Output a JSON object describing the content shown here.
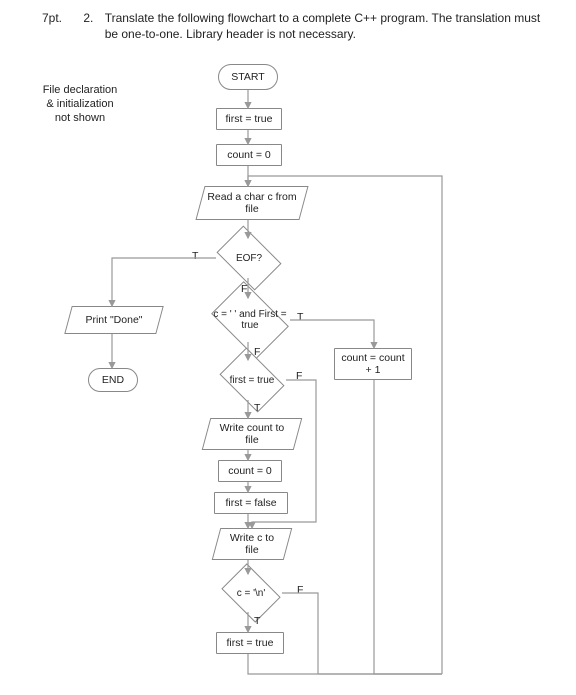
{
  "question": {
    "points": "7pt.",
    "number": "2.",
    "text": "Translate the following flowchart to a complete C++ program. The translation must be one-to-one. Library header is not necessary."
  },
  "note": {
    "line1": "File declaration",
    "line2": "& initialization",
    "line3": "not shown"
  },
  "shapes": {
    "start": "START",
    "first_init": "first = true",
    "count_init": "count = 0",
    "read_char": "Read a char c from file",
    "eof_q": "EOF?",
    "cond_space_first": "c = ' ' and First = true",
    "cond_first_true": "first = true",
    "count_inc": "count = count + 1",
    "write_count": "Write count to file",
    "count_reset": "count = 0",
    "first_false": "first = false",
    "write_c": "Write c to file",
    "cond_newline": "c = '\\n'",
    "first_set_true": "first = true",
    "print_done": "Print \"Done\"",
    "end": "END"
  },
  "labels": {
    "T": "T",
    "F": "F"
  },
  "chart_data": {
    "type": "flowchart",
    "nodes": [
      {
        "id": "start",
        "kind": "terminator",
        "label": "START"
      },
      {
        "id": "first_init",
        "kind": "process",
        "label": "first = true"
      },
      {
        "id": "count_init",
        "kind": "process",
        "label": "count = 0"
      },
      {
        "id": "read_char",
        "kind": "io",
        "label": "Read a char c from file"
      },
      {
        "id": "eof",
        "kind": "decision",
        "label": "EOF?"
      },
      {
        "id": "cond_space",
        "kind": "decision",
        "label": "c = ' ' and First = true"
      },
      {
        "id": "cond_first",
        "kind": "decision",
        "label": "first = true"
      },
      {
        "id": "count_inc",
        "kind": "process",
        "label": "count = count + 1"
      },
      {
        "id": "write_count",
        "kind": "io",
        "label": "Write count to file"
      },
      {
        "id": "count_reset",
        "kind": "process",
        "label": "count = 0"
      },
      {
        "id": "first_false",
        "kind": "process",
        "label": "first = false"
      },
      {
        "id": "write_c",
        "kind": "io",
        "label": "Write c to file"
      },
      {
        "id": "cond_nl",
        "kind": "decision",
        "label": "c = '\\n'"
      },
      {
        "id": "first_true2",
        "kind": "process",
        "label": "first = true"
      },
      {
        "id": "print_done",
        "kind": "io",
        "label": "Print \"Done\""
      },
      {
        "id": "end",
        "kind": "terminator",
        "label": "END"
      }
    ],
    "edges": [
      {
        "from": "start",
        "to": "first_init"
      },
      {
        "from": "first_init",
        "to": "count_init"
      },
      {
        "from": "count_init",
        "to": "read_char"
      },
      {
        "from": "read_char",
        "to": "eof"
      },
      {
        "from": "eof",
        "to": "print_done",
        "label": "T"
      },
      {
        "from": "eof",
        "to": "cond_space",
        "label": "F"
      },
      {
        "from": "cond_space",
        "to": "count_inc",
        "label": "T"
      },
      {
        "from": "count_inc",
        "to": "read_char"
      },
      {
        "from": "cond_space",
        "to": "cond_first",
        "label": "F"
      },
      {
        "from": "cond_first",
        "to": "write_c",
        "label": "F"
      },
      {
        "from": "cond_first",
        "to": "write_count",
        "label": "T"
      },
      {
        "from": "write_count",
        "to": "count_reset"
      },
      {
        "from": "count_reset",
        "to": "first_false"
      },
      {
        "from": "first_false",
        "to": "write_c"
      },
      {
        "from": "write_c",
        "to": "cond_nl"
      },
      {
        "from": "cond_nl",
        "to": "read_char",
        "label": "F"
      },
      {
        "from": "cond_nl",
        "to": "first_true2",
        "label": "T"
      },
      {
        "from": "first_true2",
        "to": "read_char"
      },
      {
        "from": "print_done",
        "to": "end"
      }
    ]
  }
}
